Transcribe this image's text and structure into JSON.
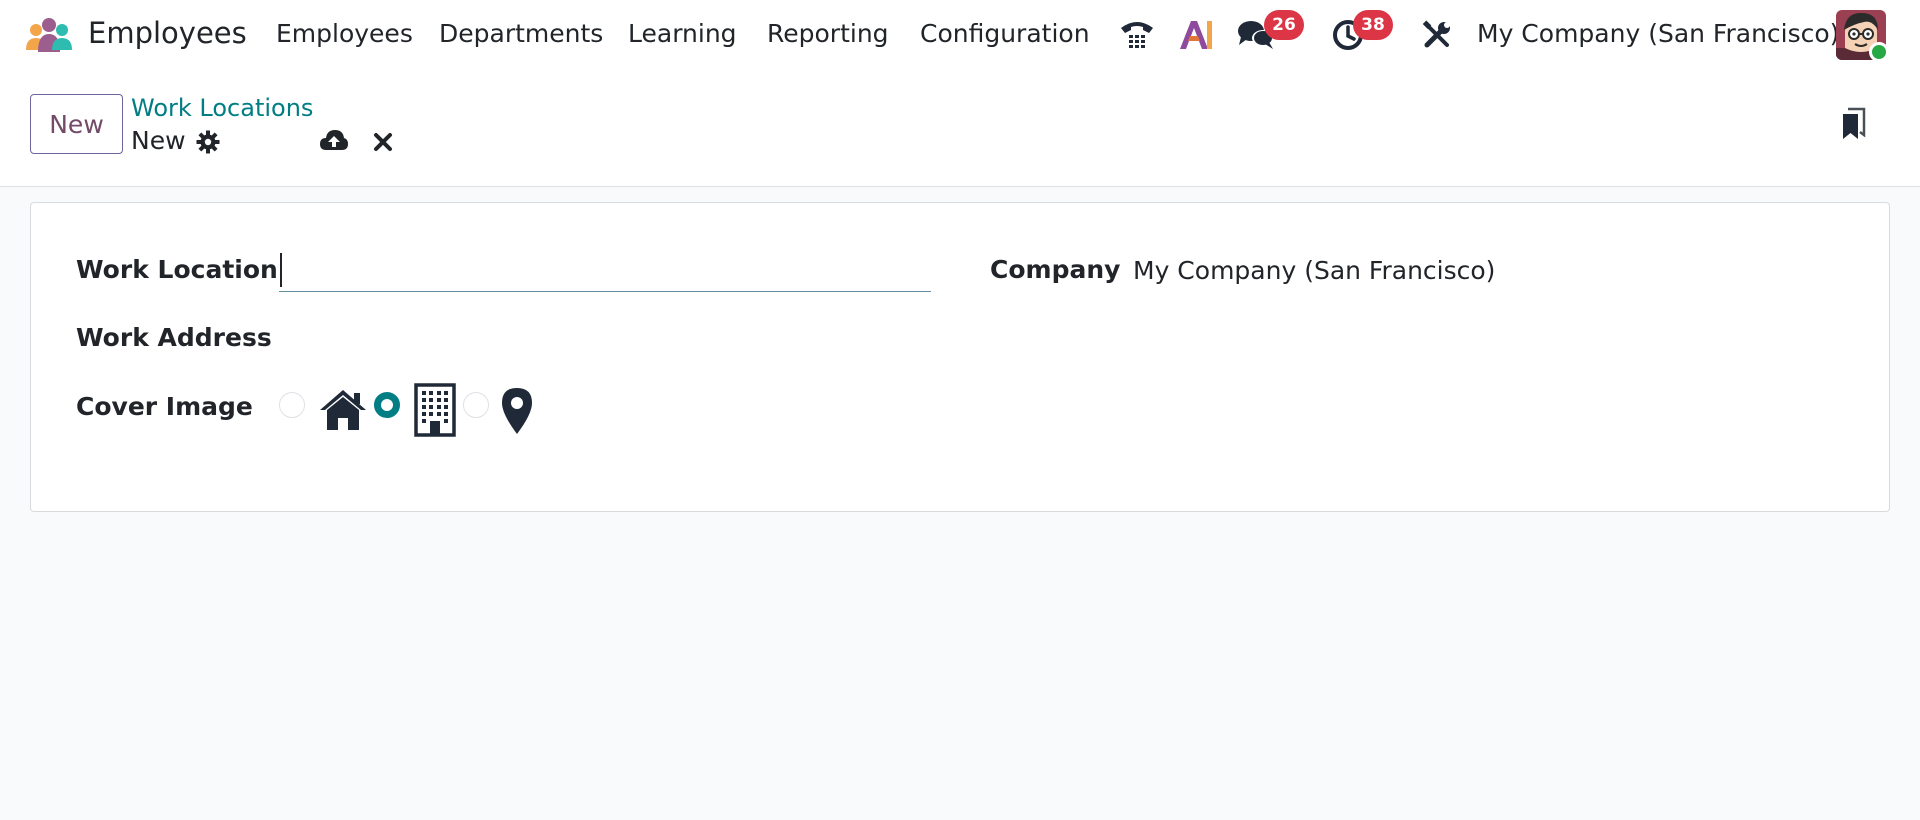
{
  "navbar": {
    "app_name": "Employees",
    "menu": [
      "Employees",
      "Departments",
      "Learning",
      "Reporting",
      "Configuration"
    ],
    "icons": [
      "phone-icon",
      "ai-icon",
      "chat-icon",
      "activity-clock-icon",
      "debug-tools-icon"
    ],
    "messages_count": "26",
    "activities_count": "38",
    "company": "My Company (San Francisco)",
    "status_color": "#28a745"
  },
  "control_panel": {
    "new_button": "New",
    "breadcrumb_parent": "Work Locations",
    "breadcrumb_current": "New",
    "icons": [
      "gear-icon",
      "cloud-upload-icon",
      "discard-icon",
      "bookmark-icon"
    ]
  },
  "form": {
    "work_location_label": "Work Location",
    "work_location_value": "",
    "company_label": "Company",
    "company_value": "My Company (San Francisco)",
    "work_address_label": "Work Address",
    "cover_image_label": "Cover Image",
    "cover_options": [
      {
        "icon": "home-icon",
        "selected": false
      },
      {
        "icon": "building-icon",
        "selected": true
      },
      {
        "icon": "map-marker-icon",
        "selected": false
      }
    ]
  },
  "colors": {
    "accent": "#017e84",
    "primary": "#714b67",
    "badge": "#dc3545"
  }
}
